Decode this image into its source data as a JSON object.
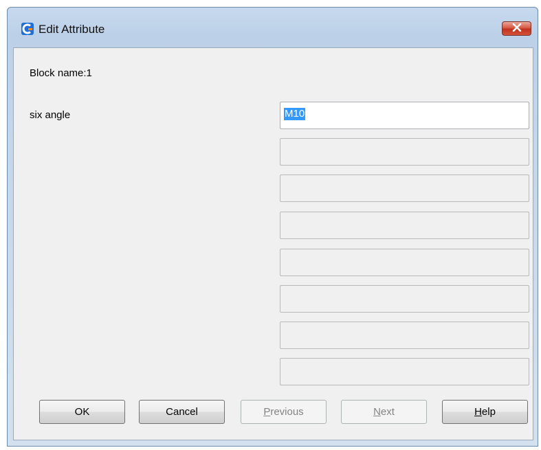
{
  "window": {
    "title": "Edit Attribute",
    "icon": "app-logo-icon",
    "close_icon": "close-icon"
  },
  "dialog": {
    "block_name_label": "Block name:",
    "block_name_value": "1",
    "attributes": [
      {
        "prompt": "six angle",
        "value": "M10"
      }
    ]
  },
  "buttons": {
    "ok": "OK",
    "cancel": "Cancel",
    "previous_first": "P",
    "previous_rest": "revious",
    "next_first": "N",
    "next_rest": "ext",
    "help_first": "H",
    "help_rest": "elp"
  },
  "colors": {
    "title_bar": "#c4d6ea",
    "close_button": "#c8432c",
    "selection": "#3399ff",
    "dialog_bg": "#f0f0f0"
  }
}
